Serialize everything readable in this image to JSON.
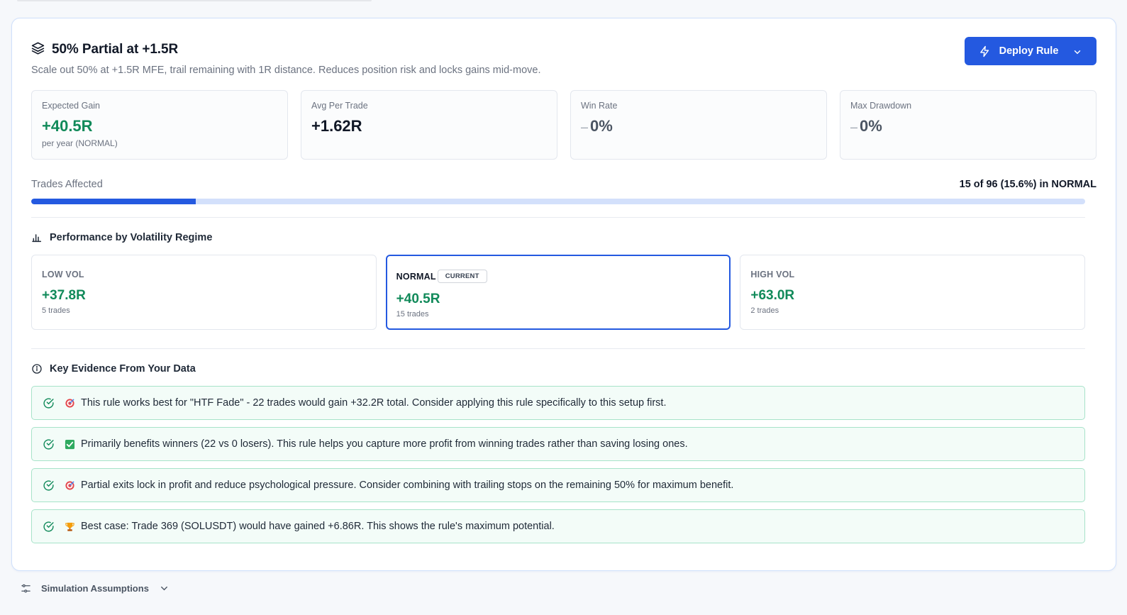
{
  "rule": {
    "title": "50% Partial at +1.5R",
    "description": "Scale out 50% at +1.5R MFE, trail remaining with 1R distance. Reduces position risk and locks gains mid-move.",
    "deploy_label": "Deploy Rule"
  },
  "stats": [
    {
      "label": "Expected Gain",
      "value": "+40.5R",
      "sub": "per year (NORMAL)"
    },
    {
      "label": "Avg Per Trade",
      "value": "+1.62R"
    },
    {
      "label": "Win Rate",
      "value": "0%"
    },
    {
      "label": "Max Drawdown",
      "value": "0%"
    }
  ],
  "affected": {
    "label": "Trades Affected",
    "count_text": "15 of 96 (15.6%) in NORMAL",
    "fraction": 0.156
  },
  "regimes": {
    "heading": "Performance by Volatility Regime",
    "items": [
      {
        "name": "LOW VOL",
        "value": "+37.8R",
        "trades": "5 trades",
        "current": false
      },
      {
        "name": "NORMAL",
        "badge": "CURRENT",
        "value": "+40.5R",
        "trades": "15 trades",
        "current": true
      },
      {
        "name": "HIGH VOL",
        "value": "+63.0R",
        "trades": "2 trades",
        "current": false
      }
    ]
  },
  "evidence": {
    "heading": "Key Evidence From Your Data",
    "items": [
      {
        "icon": "target-icon",
        "text": "This rule works best for \"HTF Fade\" - 22 trades would gain +32.2R total. Consider applying this rule specifically to this setup first."
      },
      {
        "icon": "check-mark-icon",
        "text": "Primarily benefits winners (22 vs 0 losers). This rule helps you capture more profit from winning trades rather than saving losing ones."
      },
      {
        "icon": "target-icon",
        "text": "Partial exits lock in profit and reduce psychological pressure. Consider combining with trailing stops on the remaining 50% for maximum benefit."
      },
      {
        "icon": "trophy-icon",
        "text": "Best case: Trade 369 (SOLUSDT) would have gained +6.86R. This shows the rule's maximum potential."
      }
    ]
  },
  "footer": {
    "label": "Simulation Assumptions"
  },
  "colors": {
    "accent": "#2459e0",
    "positive": "#118a5a",
    "evidence_border": "#a7e3c9"
  }
}
